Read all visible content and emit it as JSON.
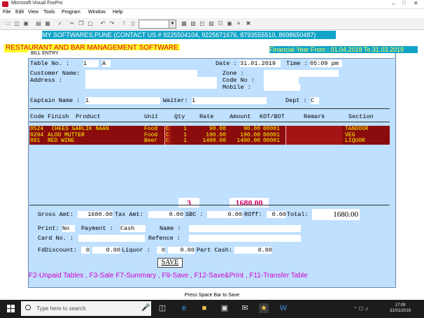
{
  "window": {
    "title": "Microsoft Visual FoxPro"
  },
  "menu": [
    "File",
    "Edit",
    "View",
    "Tools",
    "Program",
    "Window",
    "Help"
  ],
  "banners": {
    "contact": "MY SOFTWARES,PUNE (CONTACT US # 9225504104, 9225671676, 8793555510, 8698650487)",
    "restaurant": "RESTAURANT  AND  BAR  MANAGEMENT  SOFTWARE",
    "financial": "Financial Year From : 01.04.2018 To 31.03.2019"
  },
  "dialog": {
    "title": "BILL ENTRY",
    "table_no_label": "Table No.   :",
    "table_no": "1",
    "table_suffix": "A",
    "date_label": "Date :",
    "date": "31.01.2019",
    "time_label": "Time :",
    "time": "05:09 pm",
    "customer_label": "Customer Name:",
    "address_label": "Address     :",
    "zone_label": "Zone   :",
    "code_no_label": "Code No :",
    "mobile_label": "Mobile  :",
    "captain_label": "Captain Name :",
    "captain": "1",
    "waiter_label": "Waiter:",
    "waiter": "1",
    "dept_label": "Dept :",
    "dept": "C"
  },
  "grid": {
    "headers": {
      "code": "Code",
      "finish": "Finish",
      "product": "Product",
      "unit": "Unit",
      "qty": "Qty",
      "rate": "Rate",
      "amount": "Amount",
      "kot": "KOT/BOT",
      "remark": "Remark",
      "section": "Section"
    },
    "rows": [
      {
        "code": "0524",
        "product": "CHEES GARLIK NAAN",
        "unit": "Food",
        "flag": "C",
        "qty": "1",
        "rate": "90.00",
        "amount": "90.00",
        "kot": "00001",
        "remark": "",
        "section": "TANDOOR"
      },
      {
        "code": "0294",
        "product": "ALOO MUTTER",
        "unit": "Food",
        "flag": "C",
        "qty": "1",
        "rate": "190.00",
        "amount": "190.00",
        "kot": "00001",
        "remark": "",
        "section": "VEG"
      },
      {
        "code": "091",
        "product": " RED WINE",
        "unit": "Beer",
        "flag": "C",
        "qty": "1",
        "rate": "1400.00",
        "amount": "1400.00",
        "kot": "00001",
        "remark": "",
        "section": "LIQUOR"
      }
    ],
    "total_qty": "3",
    "total_amount": "1680.00"
  },
  "totals": {
    "gross_label": "Gross Amt:",
    "gross": "1680.00",
    "tax_label": "Tax Amt:",
    "tax": "0.00",
    "sbc_label": "SBC :",
    "sbc": "0.00",
    "roff_label": "ROff:",
    "roff": "0.00",
    "total_label": "Total:",
    "total": "1680.00",
    "print_label": "Print:",
    "print": "No",
    "payment_label": "Payment :",
    "payment": "Cash",
    "name_label": "Name :",
    "card_label": "Card No. :",
    "refence_label": "Refence :",
    "fddiscount_label": "FdDiscount:",
    "fddiscount_pct": "0",
    "fddiscount": "0.00",
    "liquor_label": "Liquor :",
    "liquor_pct": "0",
    "liquor": "0.00",
    "partcash_label": "Part Cash:",
    "partcash": "0.00"
  },
  "save_label": "SAVE",
  "fkeys": "F2-Unpaid Tables , F3-Sale      F7-Summary , F9-Save , F12-Save&Print , F11-Transfer Table",
  "status_hint": "Press Space Bar to Save",
  "taskbar": {
    "search_placeholder": "Type here to search",
    "time": "17:09",
    "date": "31/01/2019"
  },
  "colors": {
    "grid_bg": "#8a0c0c",
    "grid_text": "#ffff00",
    "dialog_bg": "#bfe0ff",
    "banner_cyan": "#12a4c8",
    "fkey_magenta": "#d000c8",
    "total_magenta": "#d0006a"
  }
}
